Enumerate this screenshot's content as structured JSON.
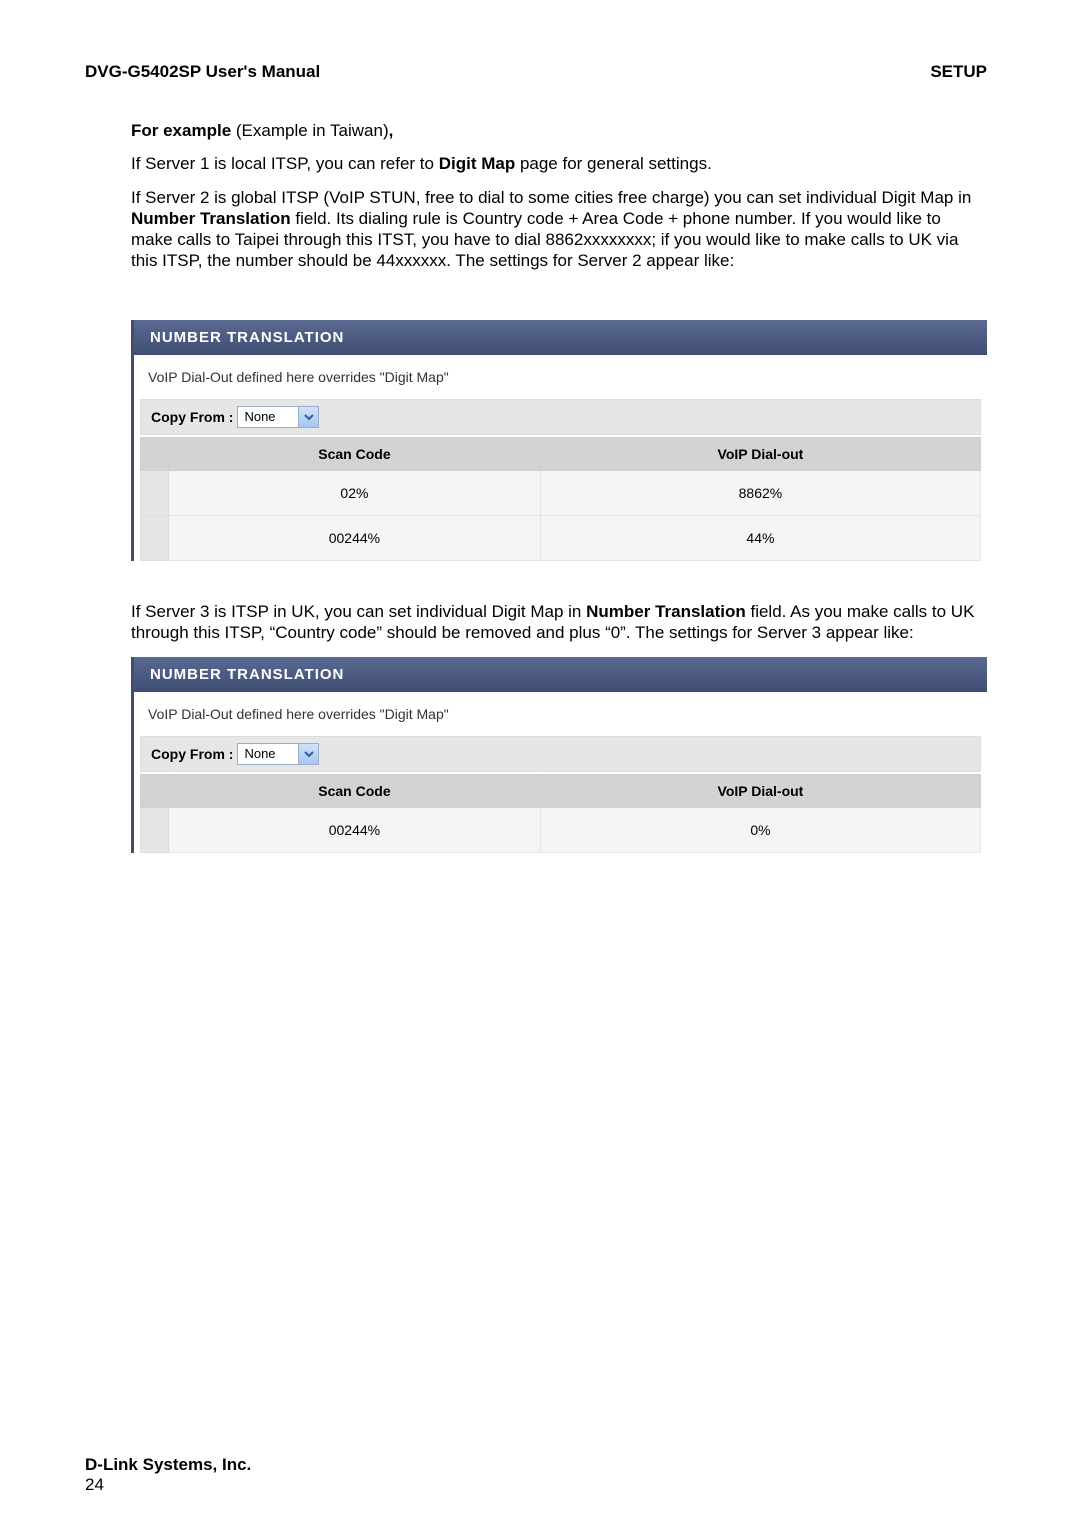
{
  "header": {
    "left": "DVG-G5402SP User's Manual",
    "right": "SETUP"
  },
  "intro": {
    "example_label": "For example",
    "example_rest": " (Example in Taiwan)",
    "example_comma": ",",
    "s1_a": "If Server 1 is local ITSP, you can refer to ",
    "s1_b": "Digit Map",
    "s1_c": " page for general settings.",
    "s2_a": "If Server 2 is global ITSP (VoIP STUN, free to dial to some cities free charge) you can set individual Digit Map in ",
    "s2_b": "Number Translation",
    "s2_c": " field. Its dialing rule is Country code + Area Code + phone number. If you would like to make calls to Taipei through this ITST, you have to dial 8862xxxxxxxx; if you would like to make calls to UK via this ITSP, the number should be 44xxxxxx. The settings for Server 2 appear like:"
  },
  "panel1": {
    "title": "NUMBER TRANSLATION",
    "overrides": "VoIP Dial-Out defined here overrides \"Digit Map\"",
    "copy_label": "Copy From :",
    "copy_value": "None",
    "headers": {
      "scan": "Scan Code",
      "dial": "VoIP Dial-out"
    },
    "rows": [
      {
        "scan": "02%",
        "dial": "8862%"
      },
      {
        "scan": "00244%",
        "dial": "44%"
      }
    ]
  },
  "mid": {
    "s3_a": "If Server 3 is ITSP in UK, you can set individual Digit Map in ",
    "s3_b": "Number Translation",
    "s3_c": " field. As you make calls to UK through this ITSP, “Country code” should be removed and plus “0”. The settings for Server 3 appear like:"
  },
  "panel2": {
    "title": "NUMBER TRANSLATION",
    "overrides": "VoIP Dial-Out defined here overrides \"Digit Map\"",
    "copy_label": "Copy From :",
    "copy_value": "None",
    "headers": {
      "scan": "Scan Code",
      "dial": "VoIP Dial-out"
    },
    "rows": [
      {
        "scan": "00244%",
        "dial": "0%"
      }
    ]
  },
  "footer": {
    "company": "D-Link Systems, Inc.",
    "page": "24"
  }
}
